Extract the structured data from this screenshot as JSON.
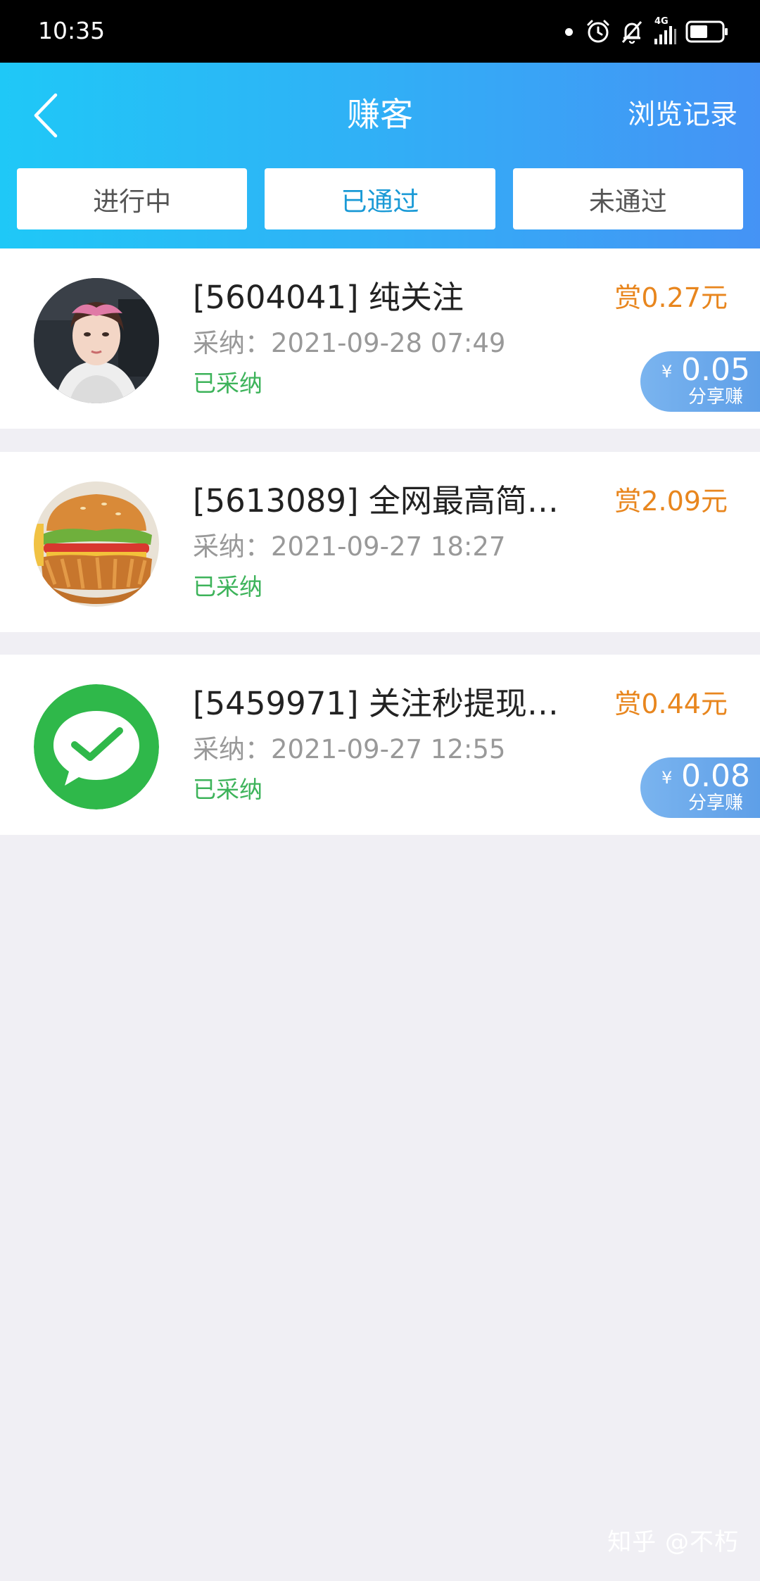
{
  "status_bar": {
    "time": "10:35",
    "network": "4G",
    "icons": [
      "notification-dot-icon",
      "alarm-icon",
      "mute-icon",
      "signal-icon",
      "battery-icon"
    ]
  },
  "header": {
    "back_icon": "chevron-left-icon",
    "title": "赚客",
    "history_link": "浏览记录"
  },
  "tabs": [
    {
      "label": "进行中",
      "active": false
    },
    {
      "label": "已通过",
      "active": true
    },
    {
      "label": "未通过",
      "active": false
    }
  ],
  "tasks": [
    {
      "title": "[5604041] 纯关注",
      "date": "采纳：2021-09-28 07:49",
      "status": "已采纳",
      "reward": "赏0.27元",
      "share": {
        "currency": "¥",
        "amount": "0.05",
        "label": "分享赚"
      },
      "avatar": "profile-photo"
    },
    {
      "title": "[5613089] 全网最高简…",
      "date": "采纳：2021-09-27 18:27",
      "status": "已采纳",
      "reward": "赏2.09元",
      "avatar": "burger-image"
    },
    {
      "title": "[5459971] 关注秒提现…",
      "date": "采纳：2021-09-27 12:55",
      "status": "已采纳",
      "reward": "赏0.44元",
      "share": {
        "currency": "¥",
        "amount": "0.08",
        "label": "分享赚"
      },
      "avatar": "wechat-logo"
    }
  ],
  "colors": {
    "header_start": "#1fc8f7",
    "header_end": "#4593f5",
    "reward": "#e8861e",
    "status_green": "#3db35a",
    "active_tab": "#1a9ad6"
  },
  "watermark": "知乎 @不朽"
}
